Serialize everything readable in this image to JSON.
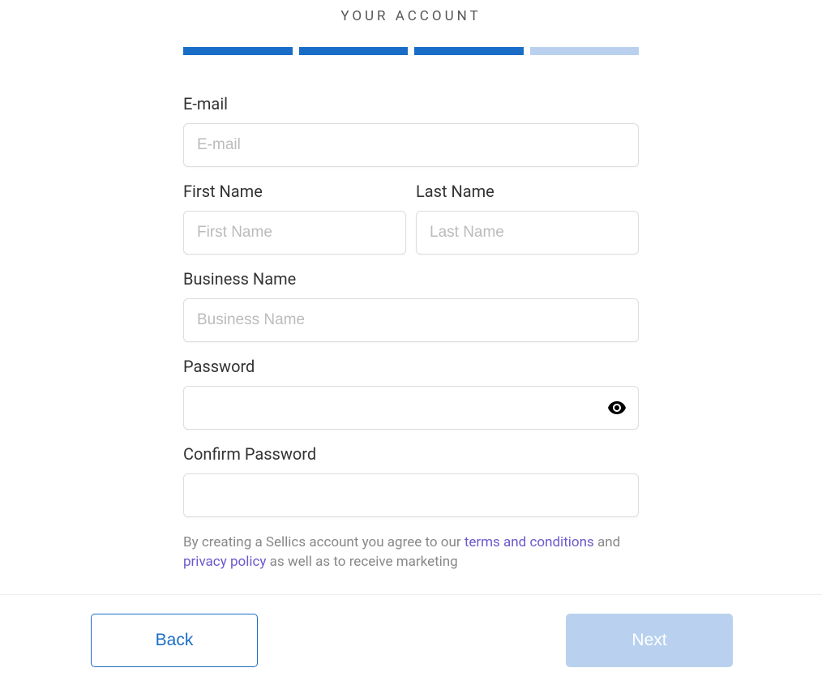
{
  "header": {
    "title": "YOUR ACCOUNT"
  },
  "progress": {
    "total_steps": 4,
    "current_step": 3
  },
  "form": {
    "email": {
      "label": "E-mail",
      "placeholder": "E-mail",
      "value": ""
    },
    "first_name": {
      "label": "First Name",
      "placeholder": "First Name",
      "value": ""
    },
    "last_name": {
      "label": "Last Name",
      "placeholder": "Last Name",
      "value": ""
    },
    "business_name": {
      "label": "Business Name",
      "placeholder": "Business Name",
      "value": ""
    },
    "password": {
      "label": "Password",
      "value": ""
    },
    "confirm_password": {
      "label": "Confirm Password",
      "value": ""
    }
  },
  "legal": {
    "part1": "By creating a Sellics account you agree to our ",
    "terms_link": "terms and conditions",
    "part2": " and ",
    "privacy_link": "privacy policy",
    "part3": " as well as to receive marketing"
  },
  "footer": {
    "back_label": "Back",
    "next_label": "Next"
  }
}
